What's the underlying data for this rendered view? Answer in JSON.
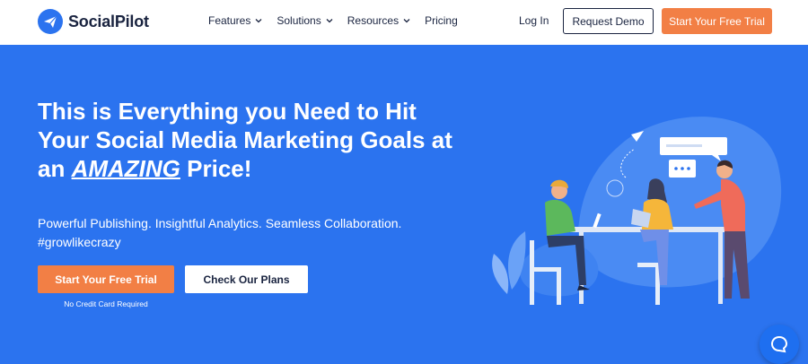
{
  "header": {
    "logo_text": "SocialPilot",
    "logo_icon": "paper-plane-icon",
    "menu": [
      {
        "label": "Features",
        "has_dropdown": true
      },
      {
        "label": "Solutions",
        "has_dropdown": true
      },
      {
        "label": "Resources",
        "has_dropdown": true
      },
      {
        "label": "Pricing",
        "has_dropdown": false
      }
    ],
    "login_label": "Log In",
    "demo_label": "Request Demo",
    "trial_label": "Start Your Free Trial"
  },
  "hero": {
    "headline_part1": "This is Everything you Need to Hit Your Social Media Marketing Goals at an ",
    "headline_emphasis": "AMAZING",
    "headline_part2": " Price!",
    "subline1": "Powerful Publishing. Insightful Analytics. Seamless Collaboration.",
    "subline2": "#growlikecrazy",
    "primary_cta": "Start Your Free Trial",
    "secondary_cta": "Check Our Plans",
    "note": "No Credit Card Required"
  },
  "chat_icon": "chat-bubble-icon",
  "colors": {
    "brand_blue": "#2b73ef",
    "accent_orange": "#f27f45",
    "navy_text": "#1a2440",
    "white": "#ffffff"
  }
}
